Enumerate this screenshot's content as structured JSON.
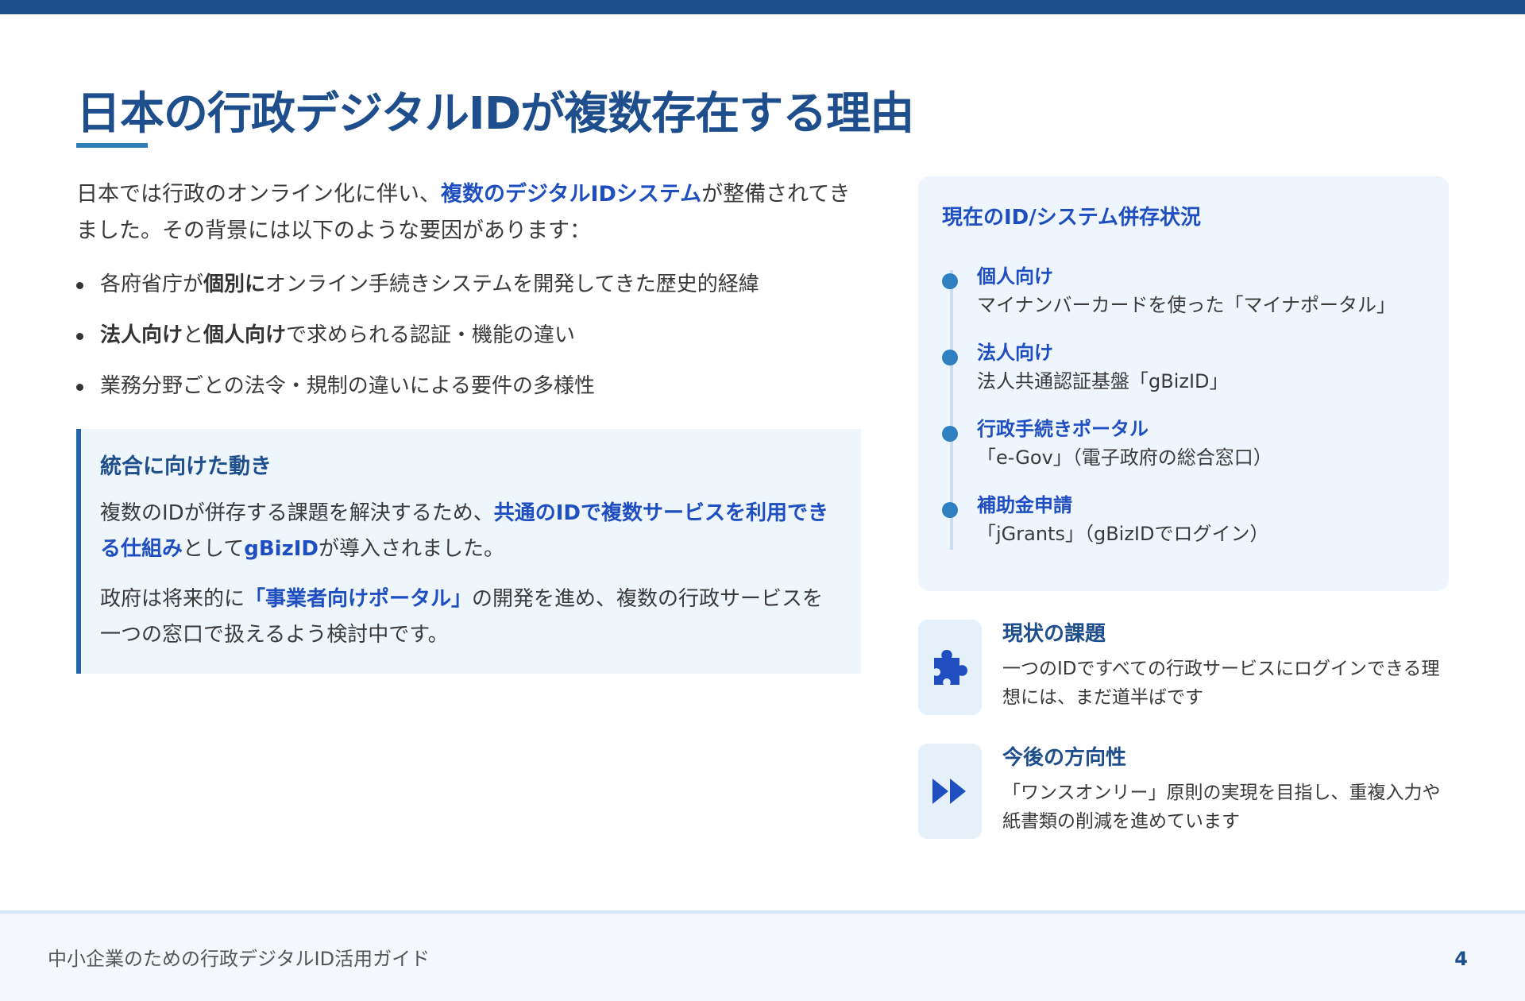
{
  "header": {
    "title": "日本の行政デジタルIDが複数存在する理由"
  },
  "intro": {
    "prefix": "日本では行政のオンライン化に伴い、",
    "highlight": "複数のデジタルIDシステム",
    "suffix": "が整備されてきました。その背景には以下のような要因があります："
  },
  "bullets": [
    {
      "pre": "各府省庁が",
      "bold": "個別に",
      "post": "オンライン手続きシステムを開発してきた歴史的経緯"
    },
    {
      "bold1": "法人向け",
      "mid": "と",
      "bold2": "個人向け",
      "post": "で求められる認証・機能の違い"
    },
    {
      "text": "業務分野ごとの法令・規制の違いによる要件の多様性"
    }
  ],
  "callout": {
    "title": "統合に向けた動き",
    "p1": {
      "pre": "複数のIDが併存する課題を解決するため、",
      "hl1": "共通のIDで複数サービスを利用できる仕組み",
      "mid": "として",
      "hl2": "gBizID",
      "post": "が導入されました。"
    },
    "p2": {
      "pre": "政府は将来的に",
      "hl": "「事業者向けポータル」",
      "post": "の開発を進め、複数の行政サービスを一つの窓口で扱えるよう検討中です。"
    }
  },
  "status": {
    "title": "現在のID/システム併存状況",
    "items": [
      {
        "label": "個人向け",
        "desc": "マイナンバーカードを使った「マイナポータル」"
      },
      {
        "label": "法人向け",
        "desc": "法人共通認証基盤「gBizID」"
      },
      {
        "label": "行政手続きポータル",
        "desc": "「e-Gov」（電子政府の総合窓口）"
      },
      {
        "label": "補助金申請",
        "desc": "「jGrants」（gBizIDでログイン）"
      }
    ]
  },
  "features": [
    {
      "icon": "puzzle-piece-icon",
      "title": "現状の課題",
      "desc": "一つのIDですべての行政サービスにログインできる理想には、まだ道半ばです"
    },
    {
      "icon": "fast-forward-icon",
      "title": "今後の方向性",
      "desc": "「ワンスオンリー」原則の実現を目指し、重複入力や紙書類の削減を進めています"
    }
  ],
  "footer": {
    "text": "中小企業のための行政デジタルID活用ガイド",
    "page": "4"
  },
  "colors": {
    "primary": "#1f4e8c",
    "accent": "#1f4ec0",
    "timeline_dot": "#2f80c0",
    "callout_bg": "#eef6fc"
  }
}
